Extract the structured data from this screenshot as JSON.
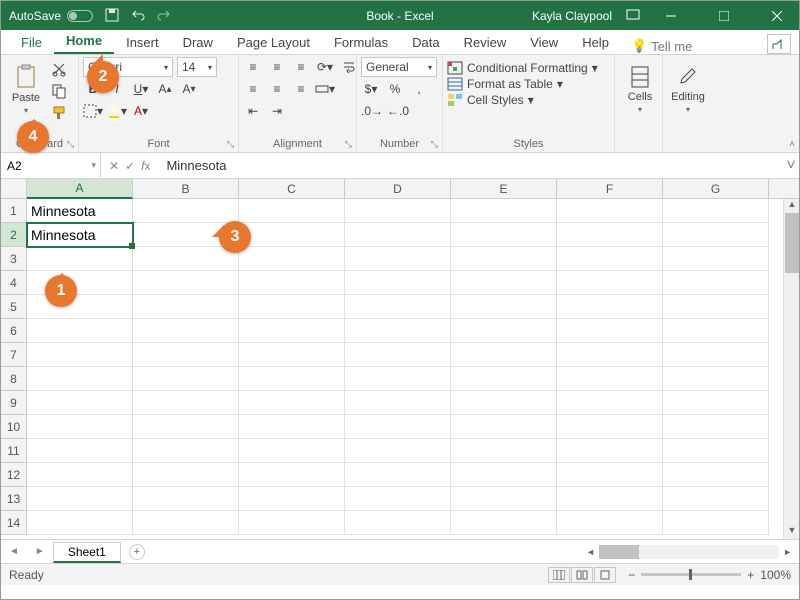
{
  "titlebar": {
    "autosave_label": "AutoSave",
    "doc_title": "Book - Excel",
    "user_name": "Kayla Claypool"
  },
  "tabs": {
    "file": "File",
    "home": "Home",
    "insert": "Insert",
    "draw": "Draw",
    "page_layout": "Page Layout",
    "formulas": "Formulas",
    "data": "Data",
    "review": "Review",
    "view": "View",
    "help": "Help",
    "tellme": "Tell me"
  },
  "ribbon": {
    "clipboard": {
      "label": "Clipboard",
      "paste": "Paste"
    },
    "font": {
      "label": "Font",
      "family": "Calibri",
      "size": "14"
    },
    "alignment": {
      "label": "Alignment"
    },
    "number": {
      "label": "Number",
      "format": "General"
    },
    "styles": {
      "label": "Styles",
      "cond_fmt": "Conditional Formatting",
      "table": "Format as Table",
      "cell_styles": "Cell Styles"
    },
    "cells": {
      "label": "Cells"
    },
    "editing": {
      "label": "Editing"
    }
  },
  "formula_bar": {
    "cell_ref": "A2",
    "value": "Minnesota"
  },
  "grid": {
    "columns": [
      "A",
      "B",
      "C",
      "D",
      "E",
      "F",
      "G"
    ],
    "rows": [
      "1",
      "2",
      "3",
      "4",
      "5",
      "6",
      "7",
      "8",
      "9",
      "10",
      "11",
      "12",
      "13",
      "14"
    ],
    "selected_col": 0,
    "selected_row": 1,
    "data": [
      [
        "Minnesota",
        "",
        "",
        "",
        "",
        "",
        ""
      ],
      [
        "Minnesota",
        "",
        "",
        "",
        "",
        "",
        ""
      ]
    ]
  },
  "sheets": {
    "active": "Sheet1"
  },
  "status": {
    "ready": "Ready",
    "zoom": "100%"
  },
  "callouts": {
    "c1": "1",
    "c2": "2",
    "c3": "3",
    "c4": "4"
  }
}
